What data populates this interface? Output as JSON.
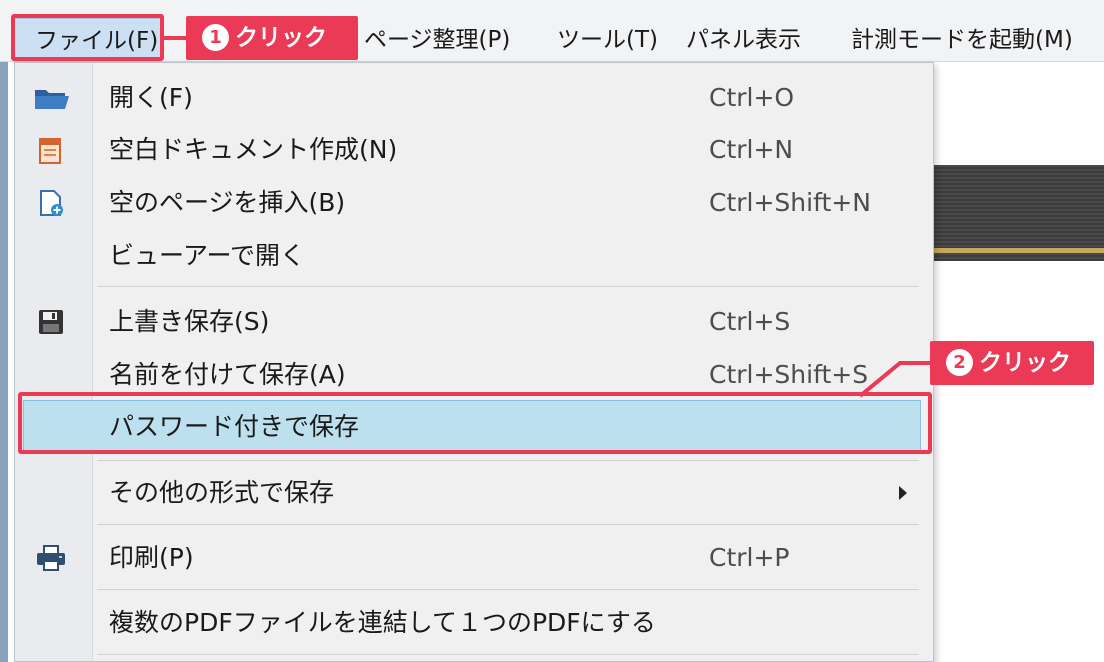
{
  "menubar": {
    "file": "ファイル(F)",
    "page": "ページ整理(P)",
    "tool": "ツール(T)",
    "panel": "パネル表示",
    "measure": "計測モードを起動(M)"
  },
  "file_menu": {
    "items": [
      {
        "label": "開く(F)",
        "shortcut": "Ctrl+O",
        "icon": "folder-open-icon"
      },
      {
        "label": "空白ドキュメント作成(N)",
        "shortcut": "Ctrl+N",
        "icon": "new-document-icon"
      },
      {
        "label": "空のページを挿入(B)",
        "shortcut": "Ctrl+Shift+N",
        "icon": "insert-page-icon"
      },
      {
        "label": "ビューアーで開く",
        "shortcut": ""
      },
      {
        "label": "上書き保存(S)",
        "shortcut": "Ctrl+S",
        "icon": "save-icon"
      },
      {
        "label": "名前を付けて保存(A)",
        "shortcut": "Ctrl+Shift+S"
      },
      {
        "label": "パスワード付きで保存",
        "shortcut": "",
        "highlighted": true
      },
      {
        "label": "その他の形式で保存",
        "shortcut": "",
        "submenu": true
      },
      {
        "label": "印刷(P)",
        "shortcut": "Ctrl+P",
        "icon": "printer-icon"
      },
      {
        "label": "複数のPDFファイルを連結して１つのPDFにする",
        "shortcut": ""
      }
    ]
  },
  "annotations": {
    "step1": {
      "num": "1",
      "text": "クリック"
    },
    "step2": {
      "num": "2",
      "text": "クリック"
    },
    "color": "#ea3a55"
  },
  "colors": {
    "highlight_bg": "#bde0ef",
    "menubar_bg": "#f2f3f5",
    "menu_bg": "#f0f0f0"
  }
}
